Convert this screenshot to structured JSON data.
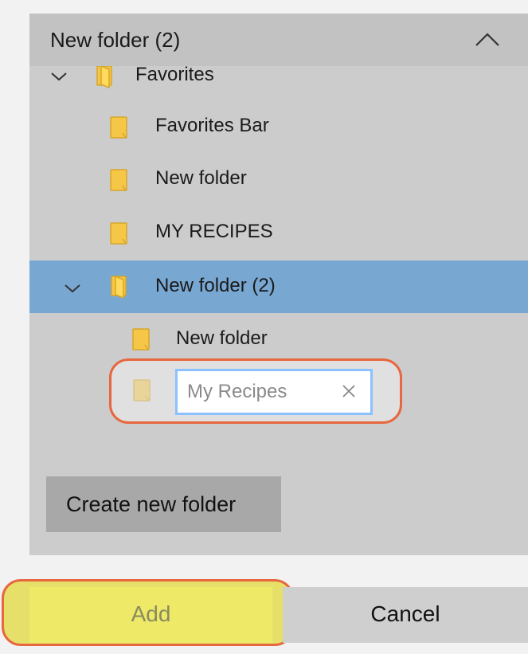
{
  "dropdown": {
    "title": "New folder (2)",
    "icon": "chevron-up-icon"
  },
  "tree": {
    "items": [
      {
        "label": "Favorites",
        "expanded": true,
        "icon": "folder-open-icon"
      },
      {
        "label": "Favorites Bar",
        "icon": "folder-icon"
      },
      {
        "label": "New folder",
        "icon": "folder-icon"
      },
      {
        "label": "MY RECIPES",
        "icon": "folder-icon"
      },
      {
        "label": "New folder (2)",
        "expanded": true,
        "selected": true,
        "icon": "folder-open-icon"
      },
      {
        "label": "New folder",
        "icon": "folder-icon"
      }
    ],
    "new_folder": {
      "placeholder": "My Recipes",
      "value": "",
      "clear_icon": "close-icon"
    }
  },
  "actions": {
    "create_folder_label": "Create new folder",
    "add_label": "Add",
    "cancel_label": "Cancel"
  },
  "colors": {
    "selected_row": "#78a7d2",
    "highlight": "#e7673f",
    "add_button": "#eeea68",
    "folder": "#f6c646"
  }
}
